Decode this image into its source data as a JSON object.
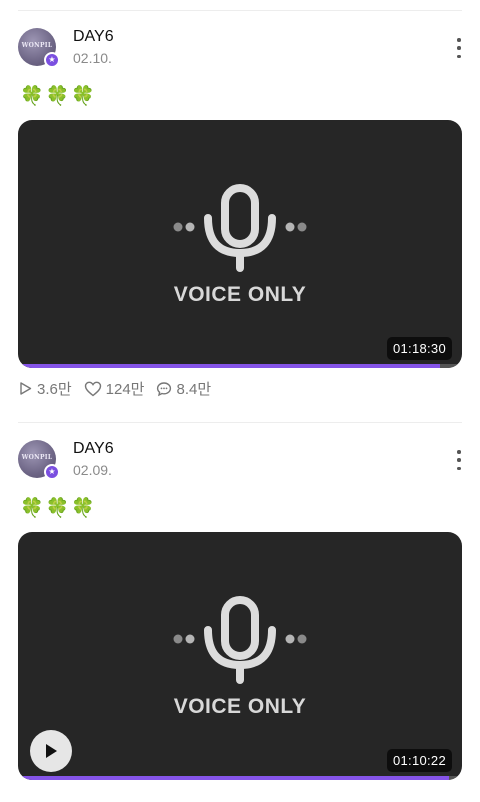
{
  "posts": [
    {
      "author": "DAY6",
      "avatar_text": "WONPIL",
      "date": "02.10.",
      "text": "🍀🍀🍀",
      "media_label": "VOICE ONLY",
      "duration": "01:18:30",
      "progress": 0.95,
      "stats": {
        "plays": "3.6만",
        "likes": "124만",
        "comments": "8.4만"
      }
    },
    {
      "author": "DAY6",
      "avatar_text": "WONPIL",
      "date": "02.09.",
      "text": "🍀🍀🍀",
      "media_label": "VOICE ONLY",
      "duration": "01:10:22",
      "progress": 0.97
    }
  ],
  "icons": {
    "badge": "star-icon",
    "more": "more-vertical-icon",
    "plays": "play-outline-icon",
    "likes": "heart-icon",
    "comments": "comment-icon",
    "mic": "microphone-icon",
    "play_button": "play-icon"
  },
  "colors": {
    "accent": "#7b4fe0",
    "progress": "#8554e8",
    "thumbnail_bg": "#262626"
  }
}
